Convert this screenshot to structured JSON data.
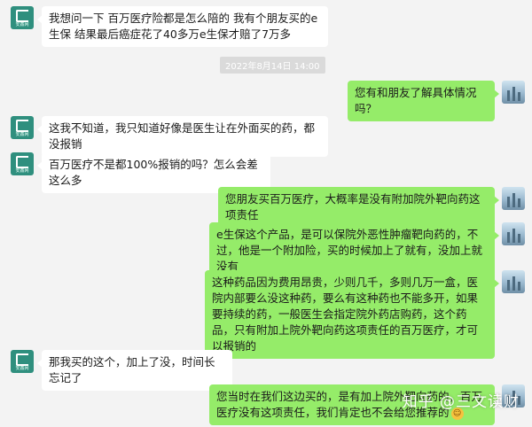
{
  "chat": {
    "timestamp": "2022年8月14日 14:00",
    "messages": [
      {
        "side": "left",
        "text": "我想问一下 百万医疗险都是怎么陪的 我有个朋友买的e生保 结果最后癌症花了40多万e生保才赔了7万多"
      },
      {
        "side": "right",
        "text": "您有和朋友了解具体情况吗？"
      },
      {
        "side": "left",
        "text": "这我不知道，我只知道好像是医生让在外面买的药，都没报销"
      },
      {
        "side": "left",
        "text": "百万医疗不是都100%报销的吗？怎么会差这么多"
      },
      {
        "side": "right",
        "text": "您朋友买百万医疗，大概率是没有附加院外靶向药这项责任"
      },
      {
        "side": "right",
        "text": "e生保这个产品，是可以保院外恶性肿瘤靶向药的，不过，他是一个附加险，买的时候加上了就有，没加上就没有"
      },
      {
        "side": "right",
        "text": "这种药品因为费用昂贵，少则几千，多则几万一盒，医院内部要么没这种药，要么有这种药也不能多开，如果要持续的药，一般医生会指定院外药店购药，这个药品，只有附加上院外靶向药这项责任的百万医疗，才可以报销的"
      },
      {
        "side": "left",
        "text": "那我买的这个，加上了没，时间长忘记了"
      },
      {
        "side": "right",
        "text": "您当时在我们这边买的，是有加上院外靶向药的，百万医疗没有这项责任，我们肯定也不会给您推荐的"
      }
    ],
    "left_avatar_label": "安鑫网",
    "emoji_name": "smile-emoji"
  },
  "watermark": "知乎 @三文读财",
  "colors": {
    "background": "#f3f3f3",
    "left_bubble": "#ffffff",
    "right_bubble": "#95ec69",
    "left_avatar": "#2f8f7e"
  }
}
